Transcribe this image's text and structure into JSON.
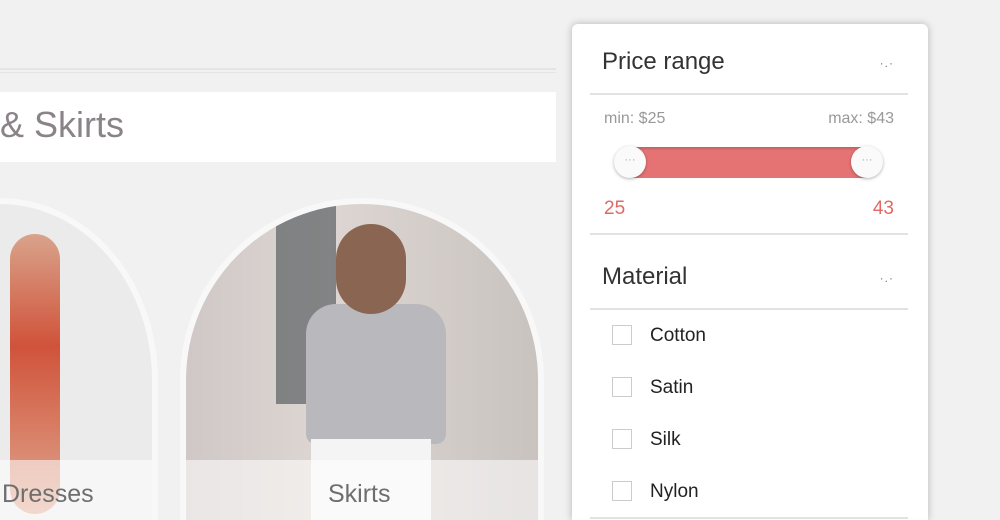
{
  "category": {
    "title": "& Skirts",
    "items": [
      {
        "label": "Dresses"
      },
      {
        "label": "Skirts"
      }
    ]
  },
  "filters": {
    "price": {
      "title": "Price range",
      "min_label": "min: $25",
      "max_label": "max: $43",
      "min_value": "25",
      "max_value": "43",
      "accent": "#e57373"
    },
    "material": {
      "title": "Material",
      "options": [
        {
          "label": "Cotton",
          "checked": false
        },
        {
          "label": "Satin",
          "checked": false
        },
        {
          "label": "Silk",
          "checked": false
        },
        {
          "label": "Nylon",
          "checked": false
        }
      ]
    },
    "collapse_icon": "chevron-down-icon"
  }
}
